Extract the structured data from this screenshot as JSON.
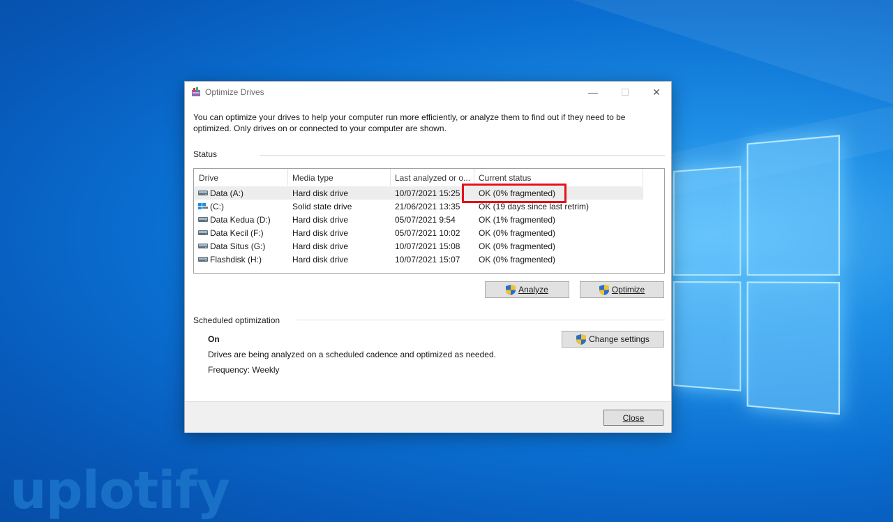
{
  "window": {
    "title": "Optimize Drives",
    "intro": "You can optimize your drives to help your computer run more efficiently, or analyze them to find out if they need to be optimized. Only drives on or connected to your computer are shown."
  },
  "status": {
    "label": "Status",
    "columns": [
      "Drive",
      "Media type",
      "Last analyzed or o...",
      "Current status"
    ],
    "rows": [
      {
        "drive": "Data (A:)",
        "media": "Hard disk drive",
        "last": "10/07/2021 15:25",
        "status": "OK (0% fragmented)",
        "icon": "hard-drive-icon",
        "selected": true
      },
      {
        "drive": "(C:)",
        "media": "Solid state drive",
        "last": "21/06/2021 13:35",
        "status": "OK (19 days since last retrim)",
        "icon": "windows-drive-icon",
        "selected": false
      },
      {
        "drive": "Data Kedua (D:)",
        "media": "Hard disk drive",
        "last": "05/07/2021 9:54",
        "status": "OK (1% fragmented)",
        "icon": "hard-drive-icon",
        "selected": false
      },
      {
        "drive": "Data Kecil (F:)",
        "media": "Hard disk drive",
        "last": "05/07/2021 10:02",
        "status": "OK (0% fragmented)",
        "icon": "hard-drive-icon",
        "selected": false
      },
      {
        "drive": "Data Situs (G:)",
        "media": "Hard disk drive",
        "last": "10/07/2021 15:08",
        "status": "OK (0% fragmented)",
        "icon": "hard-drive-icon",
        "selected": false
      },
      {
        "drive": "Flashdisk (H:)",
        "media": "Hard disk drive",
        "last": "10/07/2021 15:07",
        "status": "OK (0% fragmented)",
        "icon": "hard-drive-icon",
        "selected": false
      }
    ],
    "analyze_label": "Analyze",
    "optimize_label": "Optimize"
  },
  "schedule": {
    "label": "Scheduled optimization",
    "state": "On",
    "description": "Drives are being analyzed on a scheduled cadence and optimized as needed.",
    "frequency": "Frequency: Weekly",
    "change_settings_label": "Change settings"
  },
  "footer": {
    "close_label": "Close"
  },
  "watermark": "uplotify",
  "colors": {
    "highlight": "#e3121b",
    "desktop": "#0a6fd1"
  }
}
